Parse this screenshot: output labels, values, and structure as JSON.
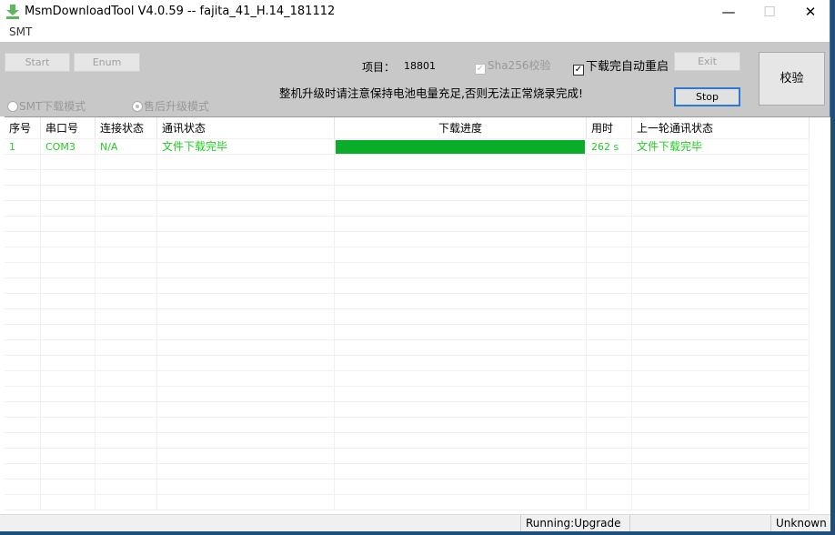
{
  "window": {
    "title": "MsmDownloadTool V4.0.59 -- fajita_41_H.14_181112",
    "minimize": "—",
    "maximize": "☐",
    "close": "✕"
  },
  "menu": {
    "smt": "SMT"
  },
  "toolbar": {
    "start": "Start",
    "enum": "Enum",
    "project_label": "项目：",
    "project_value": "18801",
    "sha256": "Sha256校验",
    "sha256_checked": true,
    "auto_reboot": "下载完自动重启",
    "auto_reboot_checked": true,
    "exit": "Exit",
    "stop": "Stop",
    "verify": "校验",
    "warning": "整机升级时请注意保持电池电量充足,否则无法正常烧录完成!",
    "mode_smt": "SMT下载模式",
    "mode_aftersales": "售后升级模式"
  },
  "table": {
    "headers": [
      "序号",
      "串口号",
      "连接状态",
      "通讯状态",
      "下载进度",
      "用时",
      "上一轮通讯状态"
    ],
    "rows": [
      {
        "index": "1",
        "port": "COM3",
        "conn": "N/A",
        "comm": "文件下载完毕",
        "progress": 100,
        "time": "262 s",
        "last": "文件下载完毕"
      }
    ]
  },
  "colors": {
    "progress": "#0aad2a",
    "ok_text": "#22cc22"
  },
  "status": {
    "running": "Running:Upgrade",
    "state": "Unknown"
  }
}
